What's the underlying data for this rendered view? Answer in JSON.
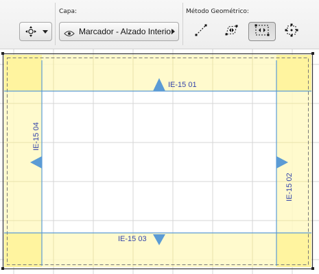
{
  "toolbar": {
    "layer_group_label": "Capa:",
    "layer_value": "Marcador - Alzado Interior",
    "geometry_group_label": "Método Geométrico:",
    "icons": {
      "placement": "target-move-icon",
      "visibility": "eye-icon",
      "method_single": "single-line-icon",
      "method_rotated_rect": "rotated-rectangle-icon",
      "method_rect": "rectangle-icon",
      "method_cross": "cross-target-icon"
    }
  },
  "markers": {
    "top": "IE-15 01",
    "right": "IE-15 02",
    "bottom": "IE-15 03",
    "left": "IE-15 04"
  },
  "colors": {
    "marker_fill": "#fff9c4",
    "marker_corner": "#fff39a",
    "boundary_line": "#5a9bd5",
    "arrow": "#5b9bd5",
    "grid": "#d3d3d3",
    "label_text": "#3344aa"
  }
}
